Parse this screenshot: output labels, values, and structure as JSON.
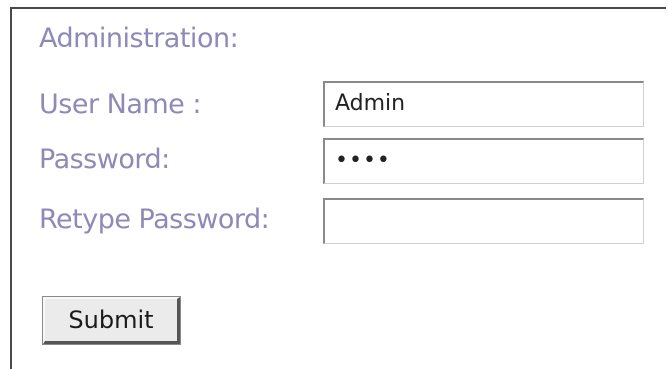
{
  "form": {
    "title": "Administration:",
    "user_name": {
      "label": "User Name :",
      "value": "Admin"
    },
    "password": {
      "label": "Password:",
      "value": "••••"
    },
    "retype_password": {
      "label": "Retype Password:",
      "value": ""
    },
    "submit_label": "Submit"
  }
}
